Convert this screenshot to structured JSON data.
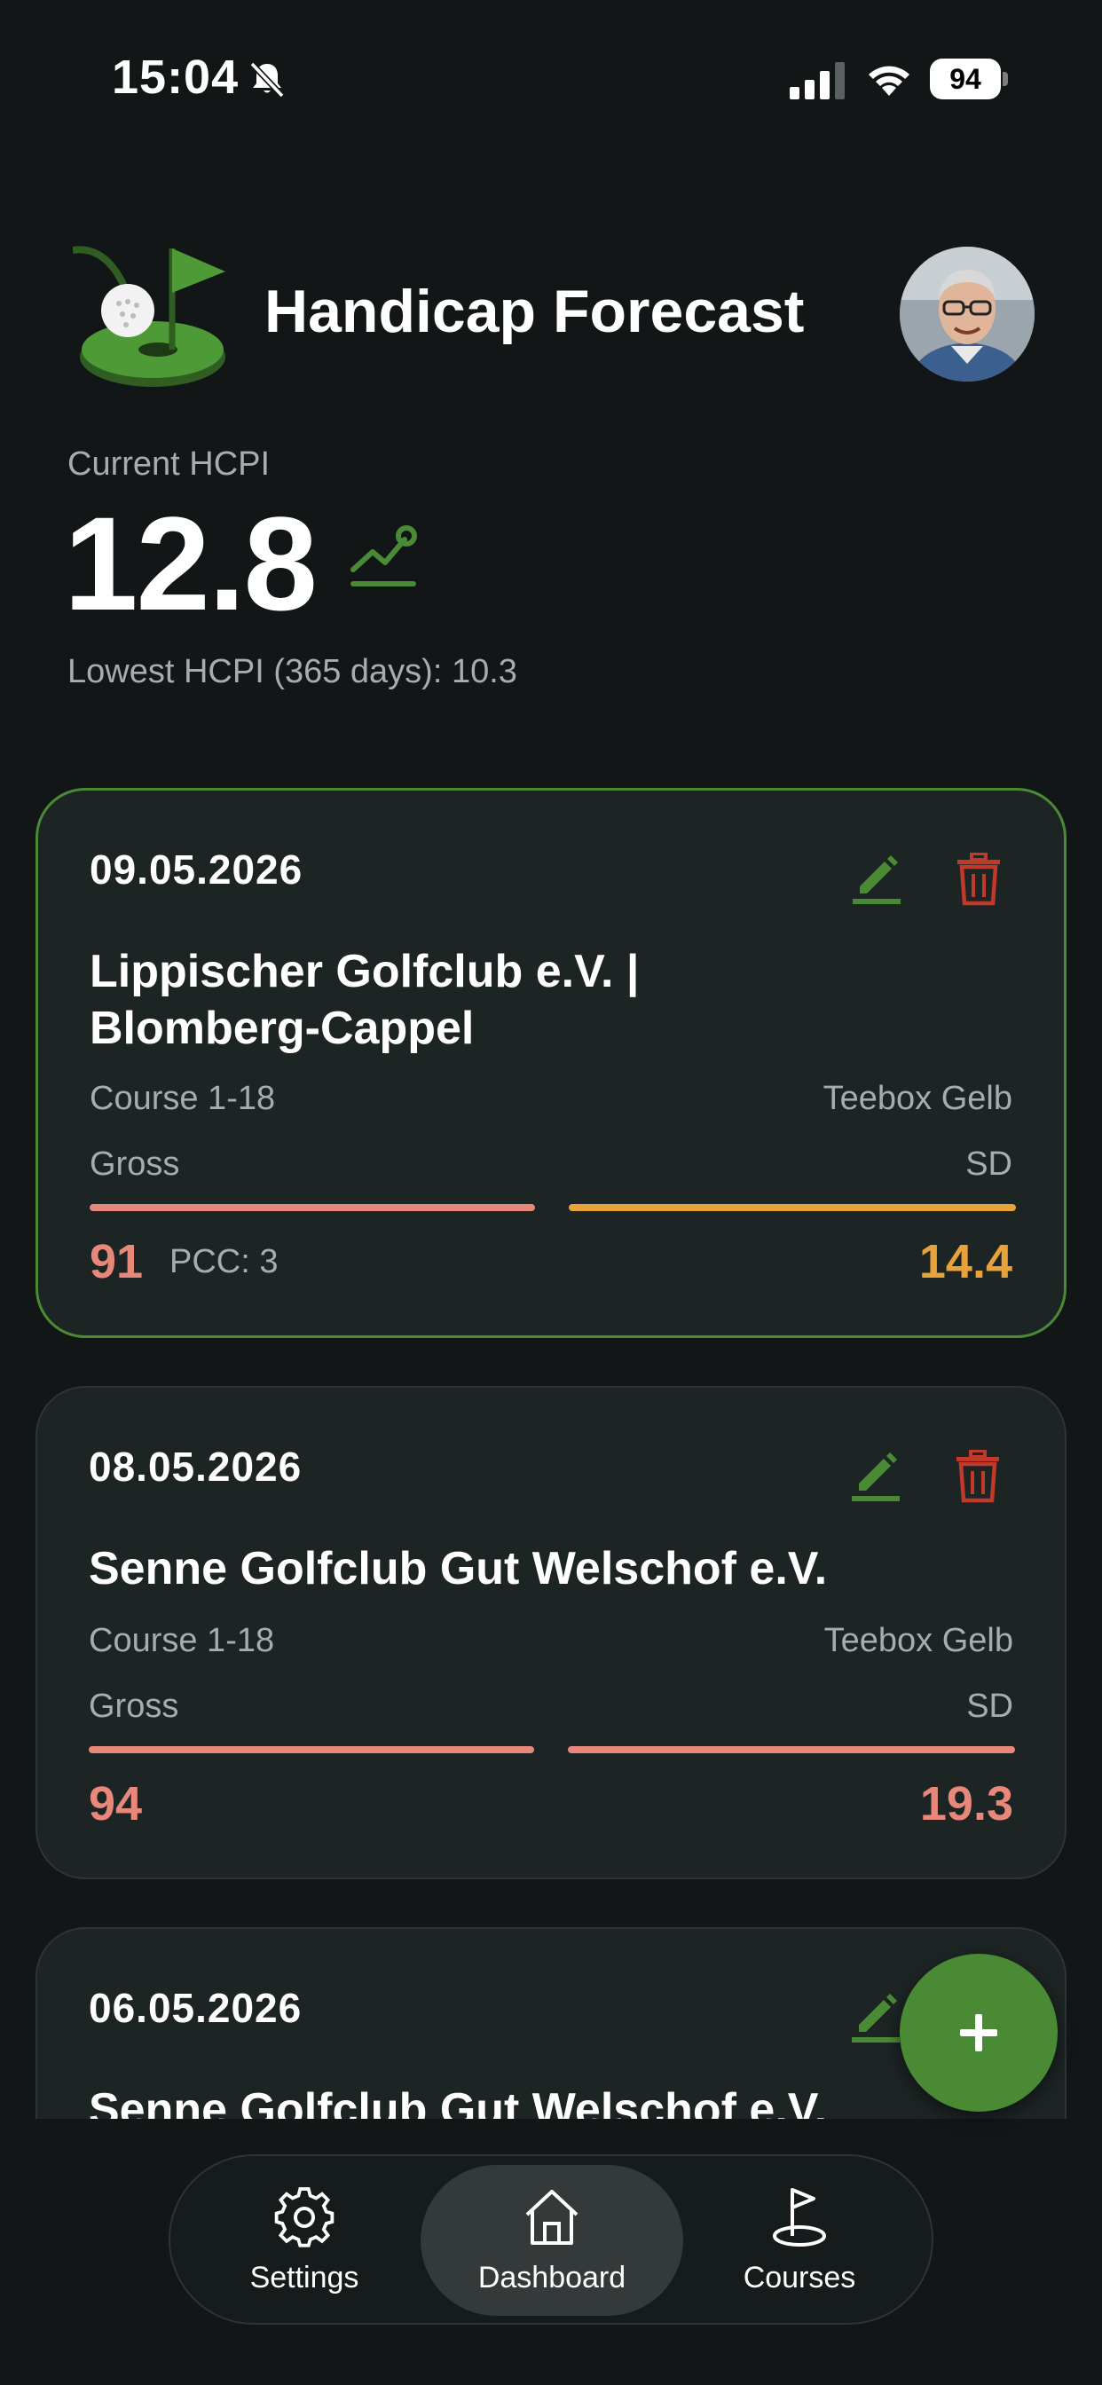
{
  "status_bar": {
    "time": "15:04",
    "battery": "94"
  },
  "header": {
    "title": "Handicap Forecast"
  },
  "hcpi": {
    "label": "Current HCPI",
    "value": "12.8",
    "lowest": "Lowest HCPI (365 days): 10.3"
  },
  "rounds": [
    {
      "date": "09.05.2026",
      "course_line1": "Lippischer Golfclub e.V. |",
      "course_line2": "Blomberg-Cappel",
      "course": "Course  1-18",
      "teebox": "Teebox  Gelb",
      "gross_label": "Gross",
      "sd_label": "SD",
      "gross": "91",
      "pcc": "PCC: 3",
      "sd": "14.4"
    },
    {
      "date": "08.05.2026",
      "course_line1": "Senne Golfclub Gut Welschof e.V.",
      "course": "Course  1-18",
      "teebox": "Teebox  Gelb",
      "gross_label": "Gross",
      "sd_label": "SD",
      "gross": "94",
      "sd": "19.3"
    },
    {
      "date": "06.05.2026",
      "course_line1": "Senne Golfclub Gut Welschof e.V."
    }
  ],
  "tabs": [
    {
      "label": "Settings",
      "icon": "gear-icon"
    },
    {
      "label": "Dashboard",
      "icon": "home-icon"
    },
    {
      "label": "Courses",
      "icon": "flag-icon"
    }
  ],
  "colors": {
    "accent_green": "#4a8a35",
    "gross_red": "#e8887a",
    "sd_orange": "#e8a23a",
    "delete_red": "#c0392b"
  }
}
